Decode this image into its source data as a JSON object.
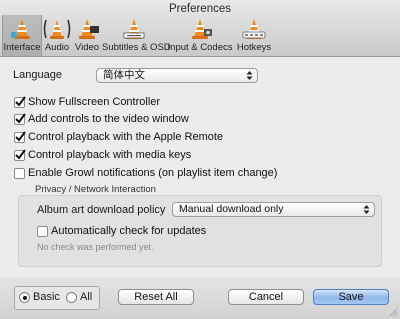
{
  "window": {
    "title": "Preferences"
  },
  "tabs": [
    {
      "label": "Interface",
      "icon": "interface-icon",
      "selected": true
    },
    {
      "label": "Audio",
      "icon": "audio-icon",
      "selected": false
    },
    {
      "label": "Video",
      "icon": "video-icon",
      "selected": false
    },
    {
      "label": "Subtitles & OSD",
      "icon": "subtitles-icon",
      "selected": false
    },
    {
      "label": "Input & Codecs",
      "icon": "input-codecs-icon",
      "selected": false
    },
    {
      "label": "Hotkeys",
      "icon": "hotkeys-icon",
      "selected": false
    }
  ],
  "language": {
    "label": "Language",
    "value": "简体中文"
  },
  "options": [
    {
      "label": "Show Fullscreen Controller",
      "checked": true
    },
    {
      "label": "Add controls to the video window",
      "checked": true
    },
    {
      "label": "Control playback with the Apple Remote",
      "checked": true
    },
    {
      "label": "Control playback with media keys",
      "checked": true
    },
    {
      "label": "Enable Growl notifications (on playlist item change)",
      "checked": false
    }
  ],
  "privacy": {
    "title": "Privacy / Network Interaction",
    "album_art_label": "Album art download policy",
    "album_art_value": "Manual download only",
    "auto_update_label": "Automatically check for updates",
    "auto_update_checked": false,
    "last_check_text": "No check was performed yet."
  },
  "footer": {
    "basic_label": "Basic",
    "all_label": "All",
    "mode_selected": "Basic",
    "reset_label": "Reset All",
    "cancel_label": "Cancel",
    "save_label": "Save"
  },
  "colors": {
    "accent": "#8fb7ea",
    "cone_orange": "#f08a1c"
  }
}
